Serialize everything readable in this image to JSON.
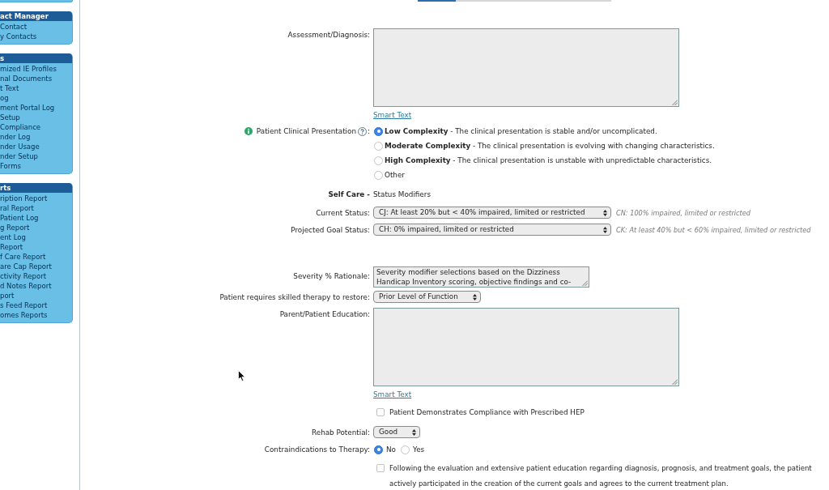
{
  "tab_strip": [
    {
      "selected": true
    },
    {
      "selected": false
    }
  ],
  "sidebar": {
    "panels": [
      {
        "title": "act Manager",
        "items": [
          "Contact",
          "y Contacts"
        ]
      },
      {
        "title": "s",
        "items": [
          "mized IE Profiles",
          "nal Documents",
          "t Text",
          "og",
          "ment Portal Log",
          "Setup",
          "Compliance",
          "nder Log",
          "nder Usage",
          "nder Setup",
          "Forms"
        ]
      },
      {
        "title": "rts",
        "items": [
          "ription Report",
          "ral Report",
          "Patient Log",
          "g Report",
          "ent Log",
          "Report",
          "f Care Report",
          "are Cap Report",
          "ctivity Report",
          "d Notes Report",
          "port",
          "s Feed Report",
          "omes Reports"
        ]
      }
    ]
  },
  "form": {
    "assessment": {
      "label": "Assessment/Diagnosis:",
      "link": "Smart Text"
    },
    "clinical_presentation": {
      "label": "Patient Clinical Presentation",
      "suffix": ":",
      "options": [
        {
          "text": "**Low Complexity** - The clinical presentation is stable and/or uncomplicated.",
          "selected": true
        },
        {
          "text": "**Moderate Complexity** - The clinical presentation is evolving with changing characteristics.",
          "selected": false
        },
        {
          "text": "**High Complexity** - The clinical presentation is unstable with unpredictable characteristics.",
          "selected": false
        },
        {
          "text": "Other",
          "selected": false
        }
      ]
    },
    "self_care": {
      "heading": "Self Care -",
      "subheading": "Status Modifiers"
    },
    "status_rows": [
      {
        "label": "Current Status:",
        "value": "CJ: At least 20% but < 40% impaired, limited or restricted",
        "hint": "CN: 100% impaired, limited or restricted"
      },
      {
        "label": "Projected Goal Status:",
        "value": "CH: 0% impaired, limited or restricted",
        "hint": "CK: At least 40% but < 60% impaired, limited or restricted"
      }
    ],
    "severity_rationale": {
      "label": "Severity % Rationale:",
      "value": "Severity modifier selections based on the Dizziness Handicap Inventory scoring, objective findings and co-"
    },
    "skilled_therapy": {
      "label": "Patient requires skilled therapy to restore:",
      "value": "Prior Level of Function"
    },
    "education": {
      "label": "Parent/Patient Education:",
      "link": "Smart Text"
    },
    "hep_compliance": {
      "label": "Patient Demonstrates Compliance with Prescribed HEP",
      "checked": false
    },
    "rehab_potential": {
      "label": "Rehab Potential:",
      "value": "Good"
    },
    "contraindications": {
      "label": "Contraindications to Therapy:",
      "options": [
        {
          "label": "No",
          "selected": true
        },
        {
          "label": "Yes",
          "selected": false
        }
      ]
    },
    "agreement": {
      "lines": [
        "Following the evaluation and extensive patient education regarding diagnosis, prognosis, and treatment goals, the patient",
        "actively participated in the creation of the current goals and agrees to the current treatment plan."
      ],
      "checked": false
    }
  }
}
